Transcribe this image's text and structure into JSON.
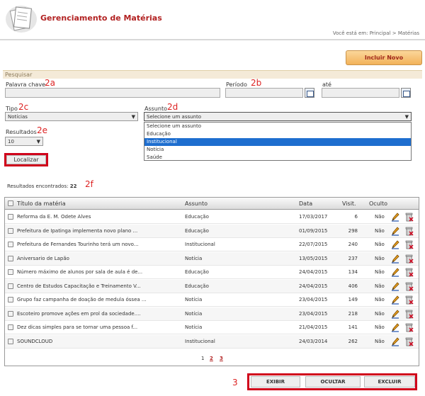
{
  "header": {
    "title": "Gerenciamento de Matérias",
    "breadcrumb": "Você está em: Principal > Matérias"
  },
  "toolbar": {
    "new_label": "Incluir Novo"
  },
  "search": {
    "section_label": "Pesquisar",
    "keyword_label": "Palavra chave",
    "period_label": "Período",
    "until_label": "até",
    "type_label": "Tipo",
    "type_value": "Notícias",
    "subject_label": "Assunto",
    "subject_value": "Selecione um assunto",
    "subject_options": [
      "Selecione um assunto",
      "Educação",
      "Institucional",
      "Notícia",
      "Saúde"
    ],
    "subject_highlighted": "Institucional",
    "results_label": "Resultados",
    "results_value": "10",
    "find_label": "Localizar"
  },
  "annotations": {
    "a2a": "2a",
    "a2b": "2b",
    "a2c": "2c",
    "a2d": "2d",
    "a2e": "2e",
    "a2f": "2f",
    "a3": "3"
  },
  "results": {
    "label": "Resultados encontrados:",
    "count": "22"
  },
  "table": {
    "headers": {
      "title": "Título da matéria",
      "subject": "Assunto",
      "date": "Data",
      "visits": "Visit.",
      "hidden": "Oculto"
    },
    "rows": [
      {
        "title": "Reforma da E. M. Odete Alves",
        "subject": "Educação",
        "date": "17/03/2017",
        "visits": "6",
        "hidden": "Não"
      },
      {
        "title": "Prefeitura de Ipatinga implementa novo plano ...",
        "subject": "Educação",
        "date": "01/09/2015",
        "visits": "298",
        "hidden": "Não"
      },
      {
        "title": "Prefeitura de Fernandes Tourinho terá um novo...",
        "subject": "Institucional",
        "date": "22/07/2015",
        "visits": "240",
        "hidden": "Não"
      },
      {
        "title": "Aniversario de Lapão",
        "subject": "Notícia",
        "date": "13/05/2015",
        "visits": "237",
        "hidden": "Não"
      },
      {
        "title": "Número máximo de alunos por sala de aula é de...",
        "subject": "Educação",
        "date": "24/04/2015",
        "visits": "134",
        "hidden": "Não"
      },
      {
        "title": "Centro de Estudos Capacitação e Treinamento V...",
        "subject": "Educação",
        "date": "24/04/2015",
        "visits": "406",
        "hidden": "Não"
      },
      {
        "title": "Grupo faz campanha de doação de medula óssea ...",
        "subject": "Notícia",
        "date": "23/04/2015",
        "visits": "149",
        "hidden": "Não"
      },
      {
        "title": "Escoteiro promove ações em prol da sociedade....",
        "subject": "Notícia",
        "date": "23/04/2015",
        "visits": "218",
        "hidden": "Não"
      },
      {
        "title": "Dez dicas simples para se tornar uma pessoa f...",
        "subject": "Notícia",
        "date": "21/04/2015",
        "visits": "141",
        "hidden": "Não"
      },
      {
        "title": "SOUNDCLOUD",
        "subject": "Institucional",
        "date": "24/03/2014",
        "visits": "262",
        "hidden": "Não"
      }
    ],
    "pages": [
      "1",
      "2",
      "3"
    ],
    "current_page": "1"
  },
  "actions": {
    "show": "EXIBIR",
    "hide": "OCULTAR",
    "delete": "EXCLUIR"
  },
  "colors": {
    "brand": "#b22222",
    "annotation": "#d0021b",
    "accent_button": "#f2b25a",
    "selection": "#1e6ecf"
  },
  "icons": {
    "logo": "documents-icon",
    "calendar": "calendar-icon",
    "edit": "pencil-icon",
    "delete": "trash-icon"
  }
}
